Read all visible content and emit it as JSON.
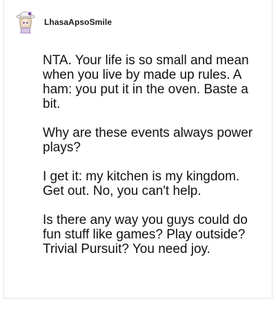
{
  "comment": {
    "author": {
      "username": "LhasaApsoSmile",
      "avatar_icon": "character-avatar-icon"
    },
    "paragraphs": [
      "NTA. Your life is so small and mean when you live by made up rules. A ham: you put it in the oven. Baste a bit.",
      "Why are these events always power plays?",
      "I get it: my kitchen is my kingdom. Get out. No, you can't help.",
      "Is there any way you guys could do fun stuff like games? Play outside? Trivial Pursuit? You need joy."
    ]
  },
  "colors": {
    "background": "#ffffff",
    "text": "#111111",
    "border": "#e4e4e4",
    "avatar_hat": "#f2f2f2",
    "avatar_accent": "#7b3fa0"
  }
}
